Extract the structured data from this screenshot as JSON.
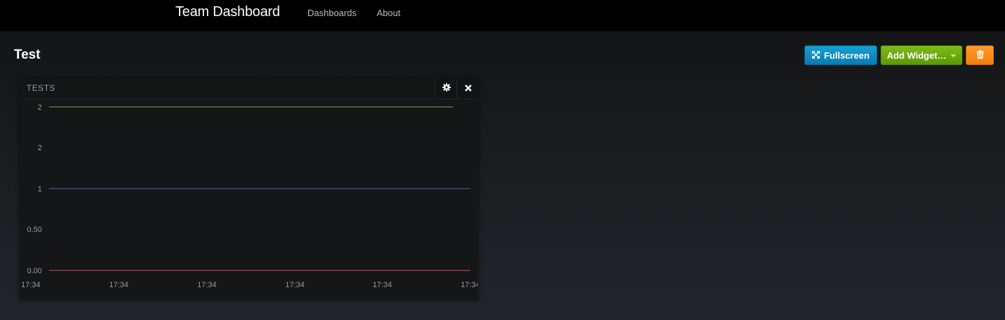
{
  "nav": {
    "brand": "Team Dashboard",
    "links": [
      "Dashboards",
      "About"
    ]
  },
  "page": {
    "title": "Test"
  },
  "toolbar": {
    "fullscreen_label": "Fullscreen",
    "add_widget_label": "Add Widget…",
    "delete_icon": "trash-icon"
  },
  "colors": {
    "fullscreen_btn": "#0a7cb3",
    "add_widget_btn": "#5c9a07",
    "delete_btn": "#f47f0b"
  },
  "widget": {
    "title": "TESTS",
    "icons": [
      "gear-icon",
      "close-icon"
    ]
  },
  "chart_data": {
    "type": "line",
    "x": [
      "17:34",
      "17:34",
      "17:34",
      "17:34",
      "17:34",
      "17:34"
    ],
    "ytick_labels": [
      "0.00",
      "0.50",
      "1",
      "2",
      "2"
    ],
    "ylim": [
      0,
      2
    ],
    "series": [
      {
        "color": "#9b9b4f",
        "values": [
          2,
          2,
          2,
          2,
          2,
          2
        ]
      },
      {
        "color": "#6b5aa6",
        "values": [
          1,
          1,
          1,
          1,
          1,
          1
        ]
      },
      {
        "color": "#b45a5a",
        "values": [
          0,
          0,
          0,
          0,
          0,
          0
        ]
      }
    ],
    "grid": false
  }
}
